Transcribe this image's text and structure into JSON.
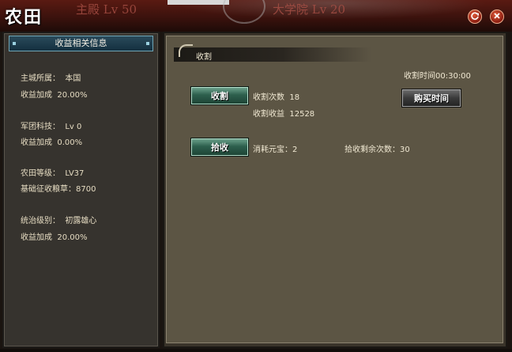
{
  "header": {
    "title": "农田",
    "background_text_1": "主殿 Lv 50",
    "background_text_2": "大学院 Lv 20",
    "help_icon": "refresh-help-icon",
    "close_icon": "close-icon"
  },
  "left_panel": {
    "title": "收益相关信息",
    "lines": [
      "主城所属：  本国",
      "收益加成  20.00%",
      "军团科技：  Lv 0",
      "收益加成  0.00%",
      "农田等级：  LV37",
      "基础征收粮草：8700",
      "统治级别：  初露雄心",
      "收益加成  20.00%"
    ]
  },
  "harvest": {
    "section_title": "收割",
    "time_label": "收割时间00:30:00",
    "harvest_button": "收割",
    "count_label": "收割次数  18",
    "income_label": "收割收益  12528",
    "buy_time_button": "购买时间"
  },
  "pick": {
    "pick_button": "拾收",
    "cost_label": "消耗元宝：2",
    "remaining_label": "拾收剩余次数：30"
  },
  "colors": {
    "header_red": "#5a1a12",
    "panel_bg": "#36332e",
    "content_bg": "#5c5544",
    "button_green": "#2d5f4d",
    "button_gray": "#3a3a3a",
    "title_bar_blue": "#143040"
  }
}
